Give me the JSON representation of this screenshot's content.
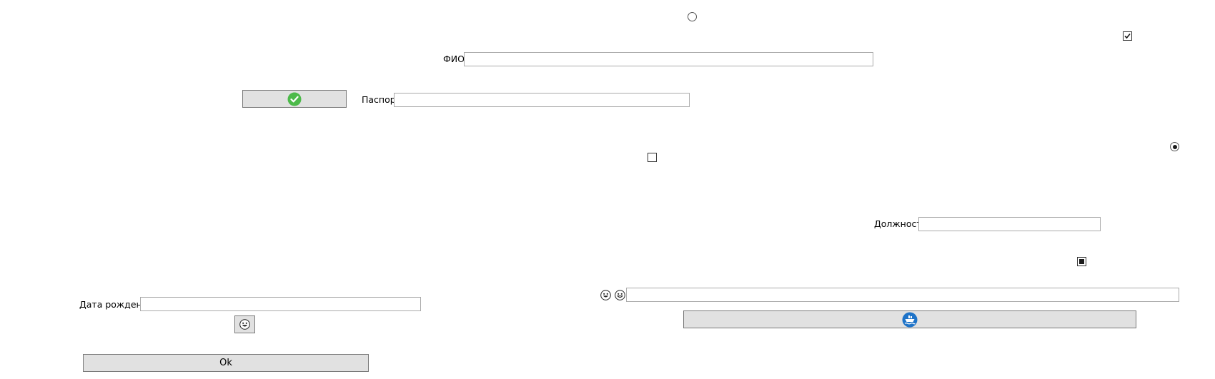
{
  "form": {
    "fio_label": "ФИО",
    "fio_value": "",
    "passport_label": "Паспорт",
    "passport_value": "",
    "position_label": "Должность",
    "position_value": "",
    "birthdate_label": "Дата рождения",
    "birthdate_value": "",
    "extra_value": ""
  },
  "buttons": {
    "ok_label": "Ok",
    "confirm_icon": "green-check-circle-icon",
    "ship_icon": "blue-ship-circle-icon",
    "emoji_icon": "grinning-face-icon"
  },
  "controls": {
    "radio_top": false,
    "radio_right": true,
    "checkbox_top_right": true,
    "checkbox_middle": false,
    "checkbox_indeterminate": "indeterminate"
  },
  "colors": {
    "button_bg": "#e1e1e1",
    "check_green": "#4cba4a",
    "ship_blue": "#1e73c8"
  }
}
